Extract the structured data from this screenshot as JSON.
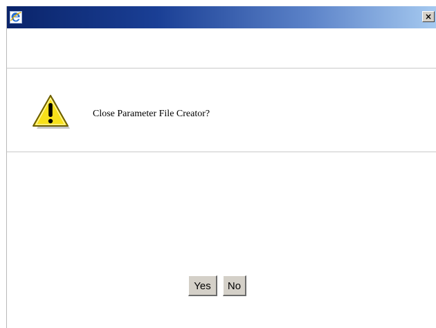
{
  "titlebar": {
    "app_icon": "internet-explorer-icon",
    "close_icon": "close-icon",
    "close_glyph": "×"
  },
  "dialog": {
    "icon": "warning-icon",
    "message": "Close Parameter File Creator?"
  },
  "buttons": {
    "yes_label": "Yes",
    "no_label": "No"
  },
  "colors": {
    "titlebar_start": "#0a246a",
    "titlebar_end": "#a6caf0",
    "warning_yellow": "#f7e11a",
    "button_face": "#d4d0c8"
  }
}
